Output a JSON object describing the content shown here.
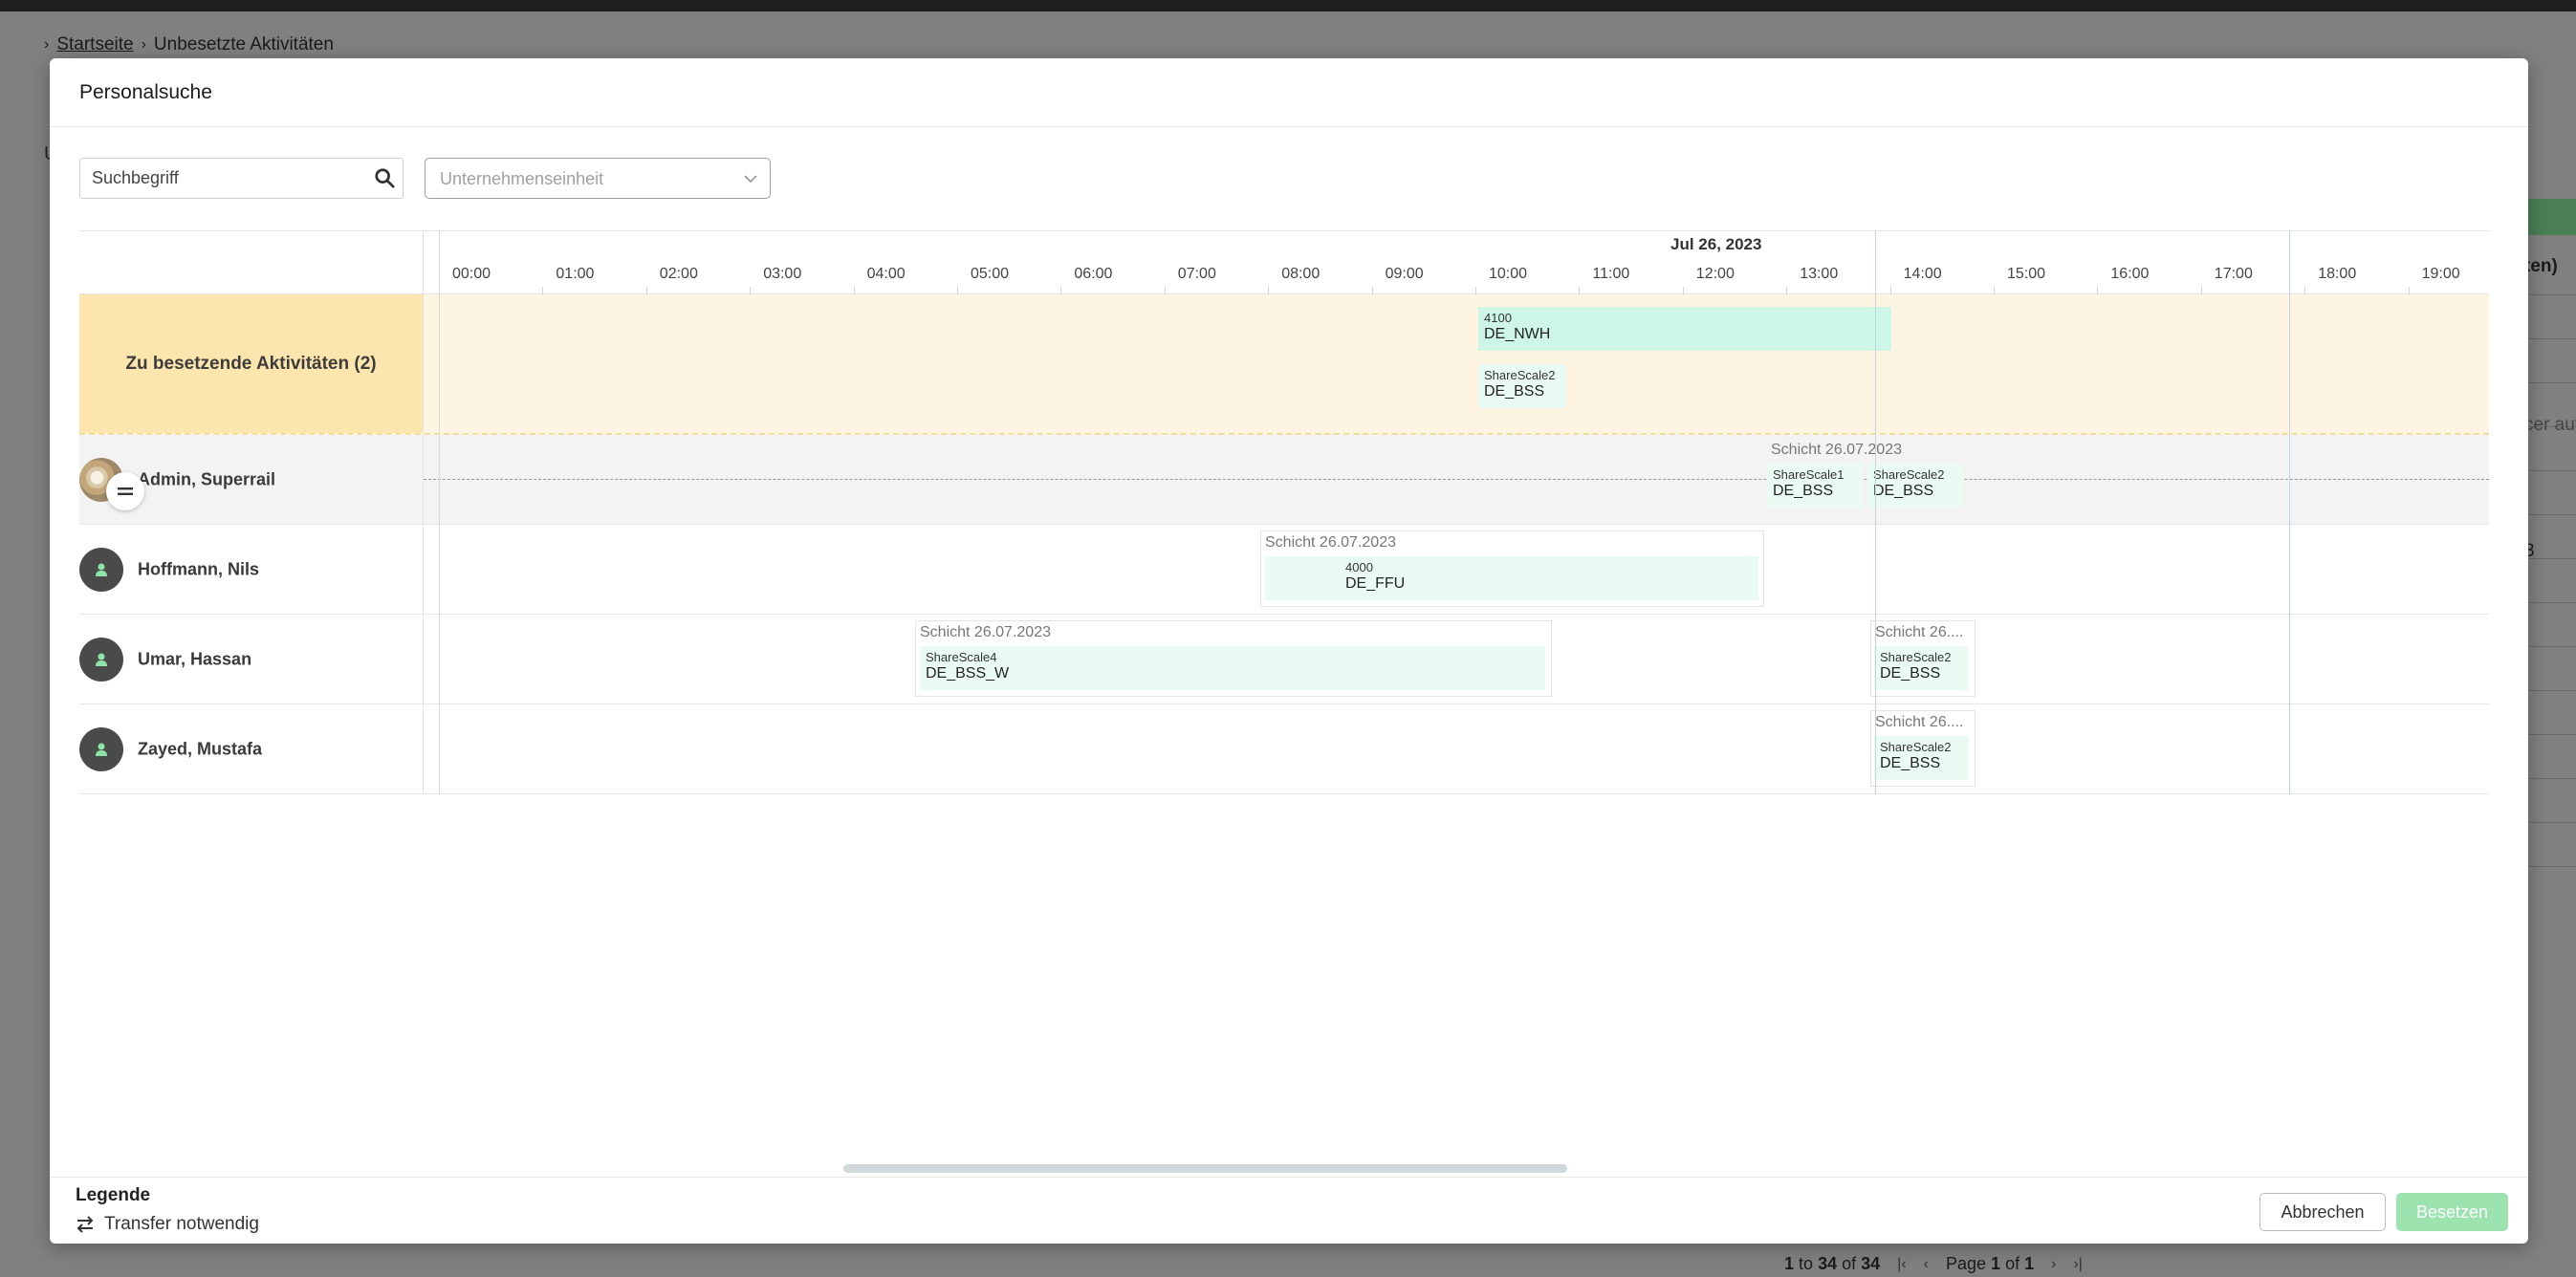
{
  "breadcrumb": {
    "home": "Startseite",
    "current": "Unbesetzte Aktivitäten"
  },
  "background": {
    "right_header": "ten)",
    "right_link": "cer auf",
    "right_value": "3",
    "left_mark": "U"
  },
  "pager": {
    "from": "1",
    "to_word": "to",
    "to": "34",
    "of_word": "of",
    "total": "34",
    "page_word": "Page",
    "page": "1",
    "of2": "of",
    "pages": "1"
  },
  "modal": {
    "title": "Personalsuche",
    "search": {
      "placeholder": "Suchbegriff"
    },
    "unit_select": {
      "placeholder": "Unternehmenseinheit"
    }
  },
  "gantt": {
    "date": "Jul 26, 2023",
    "hours": [
      "00:00",
      "01:00",
      "02:00",
      "03:00",
      "04:00",
      "05:00",
      "06:00",
      "07:00",
      "08:00",
      "09:00",
      "10:00",
      "11:00",
      "12:00",
      "13:00",
      "14:00",
      "15:00",
      "16:00",
      "17:00",
      "18:00",
      "19:00"
    ],
    "unfilled_label": "Zu besetzende Aktivitäten (2)",
    "unfilled_tasks": [
      {
        "code": "4100",
        "label": "DE_NWH"
      },
      {
        "code": "ShareScale2",
        "label": "DE_BSS"
      }
    ],
    "persons": [
      {
        "name": "Admin, Superrail",
        "shift_title": "Schicht 26.07.2023",
        "tasks": [
          {
            "code": "ShareScale1",
            "label": "DE_BSS"
          },
          {
            "code": "ShareScale2",
            "label": "DE_BSS"
          }
        ]
      },
      {
        "name": "Hoffmann, Nils",
        "shift_title": "Schicht 26.07.2023",
        "tasks": [
          {
            "code": "4000",
            "label": "DE_FFU"
          }
        ]
      },
      {
        "name": "Umar, Hassan",
        "shift_title": "Schicht 26.07.2023",
        "shift2_title": "Schicht 26....",
        "tasks": [
          {
            "code": "ShareScale4",
            "label": "DE_BSS_W"
          },
          {
            "code": "ShareScale2",
            "label": "DE_BSS"
          }
        ]
      },
      {
        "name": "Zayed, Mustafa",
        "shift_title": "Schicht 26....",
        "tasks": [
          {
            "code": "ShareScale2",
            "label": "DE_BSS"
          }
        ]
      }
    ]
  },
  "footer": {
    "legend_title": "Legende",
    "legend_item": "Transfer notwendig",
    "cancel": "Abbrechen",
    "assign": "Besetzen"
  },
  "colors": {
    "task": "#cdf6e6",
    "unfilled_left": "#fde6ad",
    "assign_button": "#9ce3b0"
  }
}
